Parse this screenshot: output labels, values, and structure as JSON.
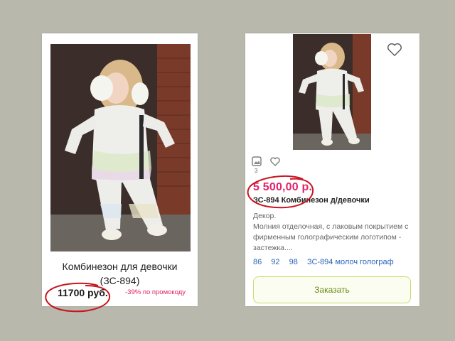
{
  "left_card": {
    "title_line1": "Комбинезон для девочки",
    "title_line2": "(ЗС-894)",
    "price": "11700 руб.",
    "promo": "-39% по промокоду"
  },
  "right_card": {
    "gallery_count": "3",
    "price": "5 500,00 р.",
    "name": "ЗС-894 Комбинезон д/девочки",
    "description": "Декор.\nМолния отделочная, с лаковым покрытием с фирменным голографическим логотипом - застежка....",
    "sizes": [
      "86",
      "92",
      "98"
    ],
    "variant_link": "ЗС-894 молоч голограф",
    "order_button": "Заказать"
  },
  "colors": {
    "background": "#b8b8ad",
    "price_pink": "#e0246a",
    "promo_red": "#e0245e",
    "link_blue": "#2a64b8",
    "button_border": "#c8dc6a",
    "annotation_red": "#c8141e"
  }
}
